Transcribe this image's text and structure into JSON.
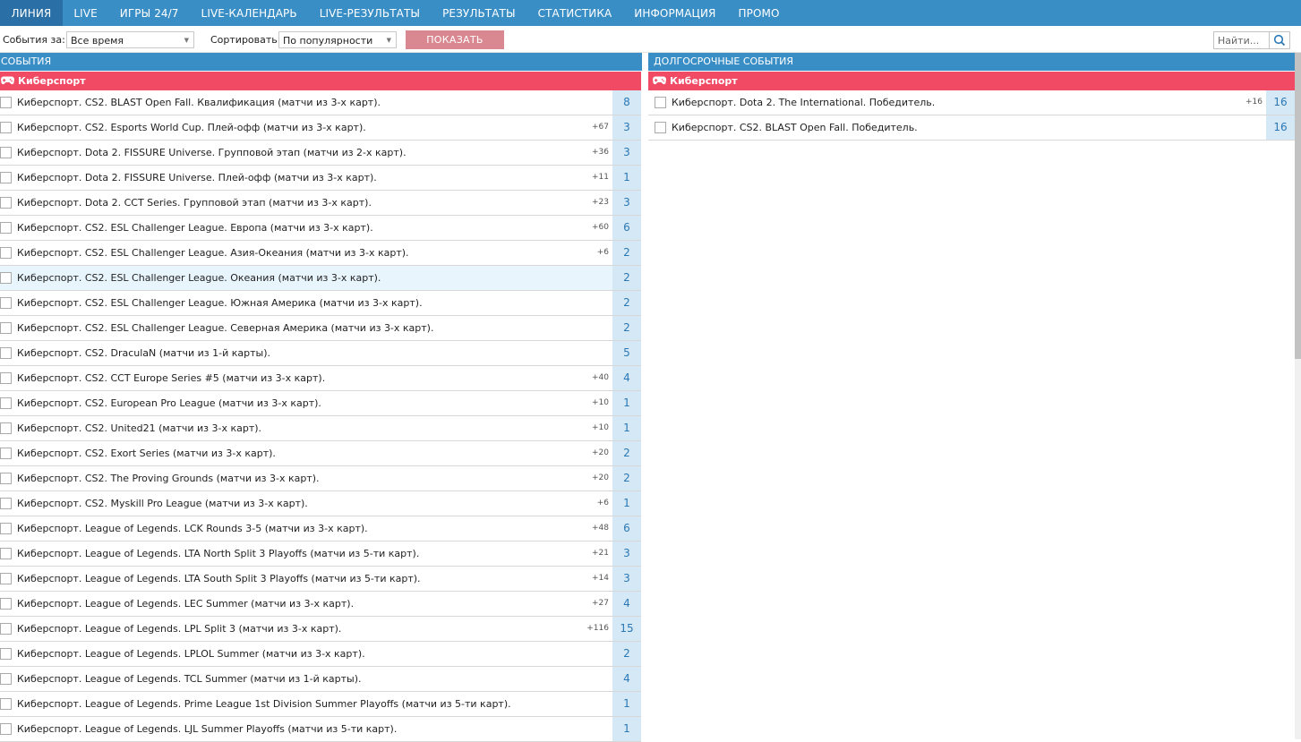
{
  "nav": {
    "items": [
      "ЛИНИЯ",
      "LIVE",
      "ИГРЫ 24/7",
      "LIVE-КАЛЕНДАРЬ",
      "LIVE-РЕЗУЛЬТАТЫ",
      "РЕЗУЛЬТАТЫ",
      "СТАТИСТИКА",
      "ИНФОРМАЦИЯ",
      "ПРОМО"
    ],
    "active": "ЛИНИЯ"
  },
  "filter": {
    "events_label": "События за:",
    "period_value": "Все время",
    "sort_label": "Сортировать",
    "sort_value": "По популярности",
    "show_button": "ПОКАЗАТЬ",
    "search_placeholder": "Найти..."
  },
  "colors": {
    "nav_bg": "#3a8ec6",
    "nav_active": "#2a6fa6",
    "sport_header": "#f04a64",
    "show_button": "#d98891",
    "count_bg": "#d4e8f6",
    "count_text": "#2b78b5"
  },
  "events": {
    "title": "СОБЫТИЯ",
    "sport": "Киберспорт",
    "sport_icon": "gamepad-icon",
    "rows": [
      {
        "name": "Киберспорт. CS2. BLAST Open Fall. Квалификация (матчи из 3-х карт).",
        "plus": "",
        "count": "8"
      },
      {
        "name": "Киберспорт. CS2. Esports World Cup. Плей-офф (матчи из 3-х карт).",
        "plus": "+67",
        "count": "3"
      },
      {
        "name": "Киберспорт. Dota 2. FISSURE Universe. Групповой этап (матчи из 2-х карт).",
        "plus": "+36",
        "count": "3"
      },
      {
        "name": "Киберспорт. Dota 2. FISSURE Universe. Плей-офф (матчи из 3-х карт).",
        "plus": "+11",
        "count": "1"
      },
      {
        "name": "Киберспорт. Dota 2. CCT Series. Групповой этап (матчи из 3-х карт).",
        "plus": "+23",
        "count": "3"
      },
      {
        "name": "Киберспорт. CS2. ESL Challenger League. Европа (матчи из 3-х карт).",
        "plus": "+60",
        "count": "6"
      },
      {
        "name": "Киберспорт. CS2. ESL Challenger League. Азия-Океания (матчи из 3-х карт).",
        "plus": "+6",
        "count": "2"
      },
      {
        "name": "Киберспорт. CS2. ESL Challenger League. Океания (матчи из 3-х карт).",
        "plus": "",
        "count": "2",
        "highlighted": true
      },
      {
        "name": "Киберспорт. CS2. ESL Challenger League. Южная Америка (матчи из 3-х карт).",
        "plus": "",
        "count": "2"
      },
      {
        "name": "Киберспорт. CS2. ESL Challenger League. Северная Америка (матчи из 3-х карт).",
        "plus": "",
        "count": "2"
      },
      {
        "name": "Киберспорт. CS2. DraculaN (матчи из 1-й карты).",
        "plus": "",
        "count": "5"
      },
      {
        "name": "Киберспорт. CS2. CCT Europe Series #5 (матчи из 3-х карт).",
        "plus": "+40",
        "count": "4"
      },
      {
        "name": "Киберспорт. CS2. European Pro League (матчи из 3-х карт).",
        "plus": "+10",
        "count": "1"
      },
      {
        "name": "Киберспорт. CS2. United21 (матчи из 3-х карт).",
        "plus": "+10",
        "count": "1"
      },
      {
        "name": "Киберспорт. CS2. Exort Series (матчи из 3-х карт).",
        "plus": "+20",
        "count": "2"
      },
      {
        "name": "Киберспорт. CS2. The Proving Grounds (матчи из 3-х карт).",
        "plus": "+20",
        "count": "2"
      },
      {
        "name": "Киберспорт. CS2. Myskill Pro League (матчи из 3-х карт).",
        "plus": "+6",
        "count": "1"
      },
      {
        "name": "Киберспорт. League of Legends. LCK Rounds 3-5 (матчи из 3-х карт).",
        "plus": "+48",
        "count": "6"
      },
      {
        "name": "Киберспорт. League of Legends. LTA North Split 3 Playoffs (матчи из 5-ти карт).",
        "plus": "+21",
        "count": "3"
      },
      {
        "name": "Киберспорт. League of Legends. LTA South Split 3 Playoffs (матчи из 5-ти карт).",
        "plus": "+14",
        "count": "3"
      },
      {
        "name": "Киберспорт. League of Legends. LEC Summer (матчи из 3-х карт).",
        "plus": "+27",
        "count": "4"
      },
      {
        "name": "Киберспорт. League of Legends. LPL Split 3 (матчи из 3-х карт).",
        "plus": "+116",
        "count": "15"
      },
      {
        "name": "Киберспорт. League of Legends. LPLOL Summer (матчи из 3-х карт).",
        "plus": "",
        "count": "2"
      },
      {
        "name": "Киберспорт. League of Legends. TCL Summer (матчи из 1-й карты).",
        "plus": "",
        "count": "4"
      },
      {
        "name": "Киберспорт. League of Legends. Prime League 1st Division Summer Playoffs (матчи из 5-ти карт).",
        "plus": "",
        "count": "1"
      },
      {
        "name": "Киберспорт. League of Legends. LJL Summer Playoffs (матчи из 5-ти карт).",
        "plus": "",
        "count": "1"
      }
    ]
  },
  "long_term": {
    "title": "ДОЛГОСРОЧНЫЕ СОБЫТИЯ",
    "sport": "Киберспорт",
    "sport_icon": "gamepad-icon",
    "rows": [
      {
        "name": "Киберспорт. Dota 2. The International. Победитель.",
        "plus": "+16",
        "count": "16"
      },
      {
        "name": "Киберспорт. CS2. BLAST Open Fall. Победитель.",
        "plus": "",
        "count": "16"
      }
    ]
  }
}
